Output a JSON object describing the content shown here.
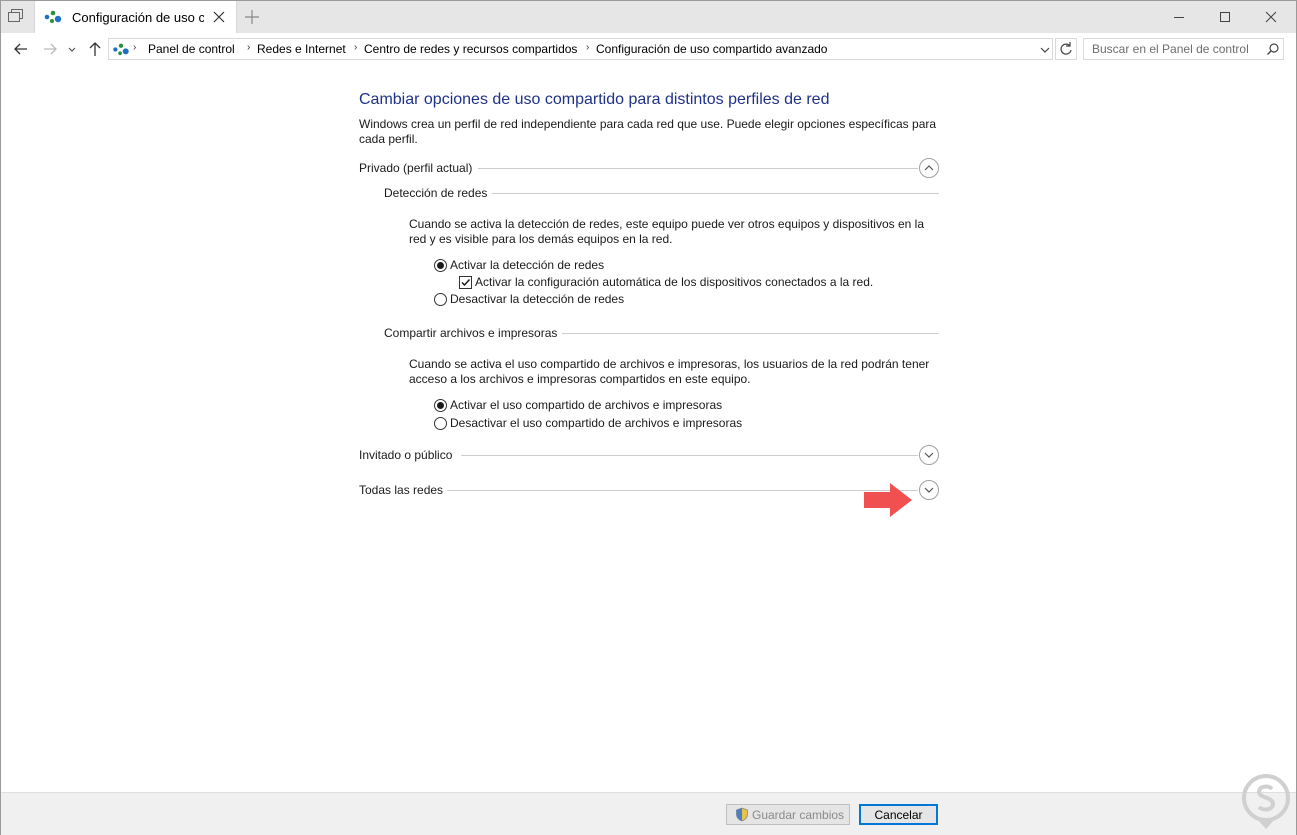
{
  "window": {
    "tab_title": "Configuración de uso c",
    "icons": {
      "tab": "network-sharing-icon",
      "minimize": "minimize-icon",
      "maximize": "maximize-icon",
      "close": "close-icon"
    }
  },
  "address_bar": {
    "breadcrumbs": [
      "Panel de control",
      "Redes e Internet",
      "Centro de redes y recursos compartidos",
      "Configuración de uso compartido avanzado"
    ],
    "search_placeholder": "Buscar en el Panel de control"
  },
  "main": {
    "title": "Cambiar opciones de uso compartido para distintos perfiles de red",
    "intro": "Windows crea un perfil de red independiente para cada red que use. Puede elegir opciones específicas para cada perfil.",
    "profiles": [
      {
        "label": "Privado (perfil actual)",
        "expanded": true,
        "groups": [
          {
            "heading": "Detección de redes",
            "description": "Cuando se activa la detección de redes, este equipo puede ver otros equipos y dispositivos en la red y es visible para los demás equipos en la red.",
            "options": [
              {
                "label": "Activar la detección de redes",
                "kind": "radio",
                "checked": true
              },
              {
                "label": "Activar la configuración automática de los dispositivos conectados a la red.",
                "kind": "checkbox",
                "checked": true
              },
              {
                "label": "Desactivar la detección de redes",
                "kind": "radio",
                "checked": false
              }
            ]
          },
          {
            "heading": "Compartir archivos e impresoras",
            "description": "Cuando se activa el uso compartido de archivos e impresoras, los usuarios de la red podrán tener acceso a los archivos e impresoras compartidos en este equipo.",
            "options": [
              {
                "label": "Activar el uso compartido de archivos e impresoras",
                "kind": "radio",
                "checked": true
              },
              {
                "label": "Desactivar el uso compartido de archivos e impresoras",
                "kind": "radio",
                "checked": false
              }
            ]
          }
        ]
      },
      {
        "label": "Invitado o público",
        "expanded": false
      },
      {
        "label": "Todas las redes",
        "expanded": false
      }
    ]
  },
  "footer": {
    "save_label": "Guardar cambios",
    "cancel_label": "Cancelar"
  },
  "colors": {
    "title_blue": "#1e3287",
    "focus_blue": "#0078d7",
    "annotation_arrow": "#f0504f"
  }
}
